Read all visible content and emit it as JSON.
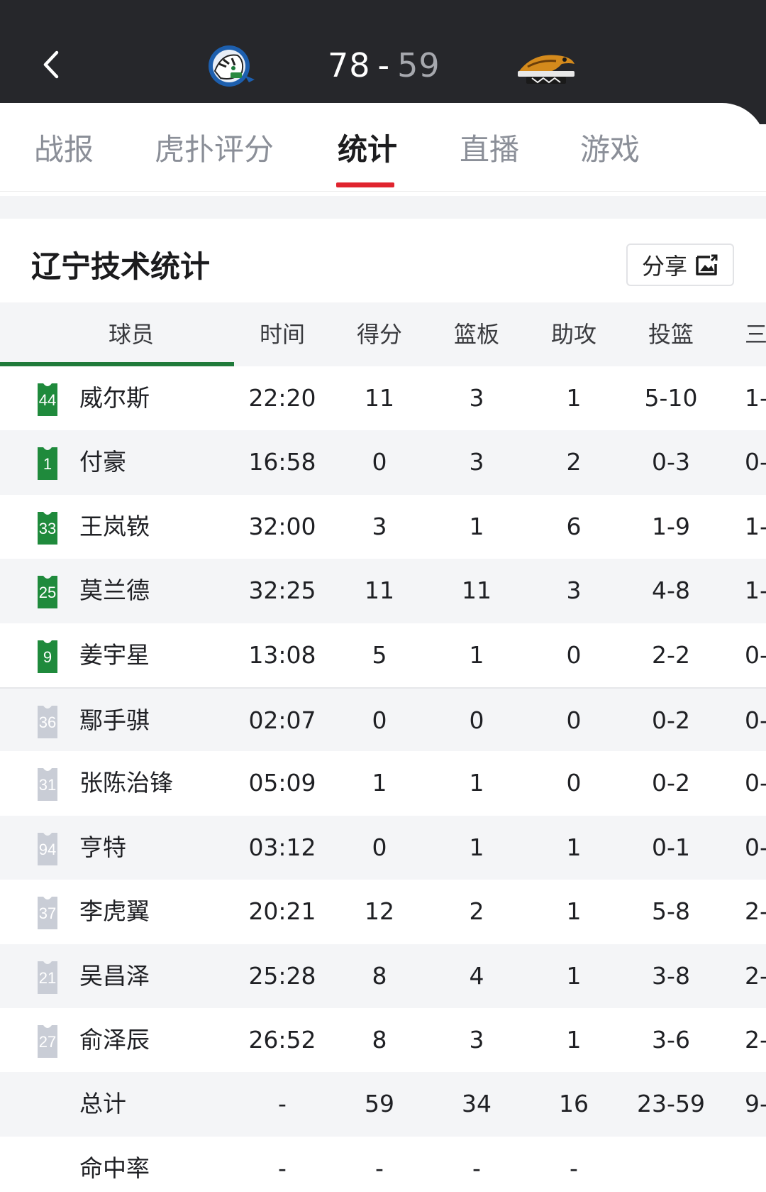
{
  "header": {
    "home_score": "78",
    "separator": "-",
    "away_score": "59",
    "home_logo": "flying-tigers-logo",
    "away_logo": "liaoning-leopards-logo"
  },
  "tabs": [
    {
      "label": "战报",
      "active": false
    },
    {
      "label": "虎扑评分",
      "active": false
    },
    {
      "label": "统计",
      "active": true
    },
    {
      "label": "直播",
      "active": false
    },
    {
      "label": "游戏",
      "active": false
    }
  ],
  "section": {
    "title": "辽宁技术统计",
    "share_label": "分享",
    "share_icon": "image-share-icon"
  },
  "colors": {
    "header_bg": "#26272b",
    "active_tab_indicator": "#e0242e",
    "starter_jersey": "#1f8a3c",
    "bench_jersey": "#c9cdd6",
    "player_tab_underline": "#1f7a3a"
  },
  "table": {
    "headers": [
      "球员",
      "时间",
      "得分",
      "篮板",
      "助攻",
      "投篮",
      "三"
    ],
    "rows": [
      {
        "num": "44",
        "name": "威尔斯",
        "time": "22:20",
        "pts": "11",
        "reb": "3",
        "ast": "1",
        "fg": "5-10",
        "tp": "1-",
        "starter": true
      },
      {
        "num": "1",
        "name": "付豪",
        "time": "16:58",
        "pts": "0",
        "reb": "3",
        "ast": "2",
        "fg": "0-3",
        "tp": "0-",
        "starter": true
      },
      {
        "num": "33",
        "name": "王岚嵚",
        "time": "32:00",
        "pts": "3",
        "reb": "1",
        "ast": "6",
        "fg": "1-9",
        "tp": "1-",
        "starter": true
      },
      {
        "num": "25",
        "name": "莫兰德",
        "time": "32:25",
        "pts": "11",
        "reb": "11",
        "ast": "3",
        "fg": "4-8",
        "tp": "1-",
        "starter": true
      },
      {
        "num": "9",
        "name": "姜宇星",
        "time": "13:08",
        "pts": "5",
        "reb": "1",
        "ast": "0",
        "fg": "2-2",
        "tp": "0-",
        "starter": true
      },
      {
        "num": "36",
        "name": "鄢手骐",
        "time": "02:07",
        "pts": "0",
        "reb": "0",
        "ast": "0",
        "fg": "0-2",
        "tp": "0-",
        "starter": false
      },
      {
        "num": "31",
        "name": "张陈治锋",
        "time": "05:09",
        "pts": "1",
        "reb": "1",
        "ast": "0",
        "fg": "0-2",
        "tp": "0-",
        "starter": false
      },
      {
        "num": "94",
        "name": "亨特",
        "time": "03:12",
        "pts": "0",
        "reb": "1",
        "ast": "1",
        "fg": "0-1",
        "tp": "0-",
        "starter": false
      },
      {
        "num": "37",
        "name": "李虎翼",
        "time": "20:21",
        "pts": "12",
        "reb": "2",
        "ast": "1",
        "fg": "5-8",
        "tp": "2-",
        "starter": false
      },
      {
        "num": "21",
        "name": "吴昌泽",
        "time": "25:28",
        "pts": "8",
        "reb": "4",
        "ast": "1",
        "fg": "3-8",
        "tp": "2-",
        "starter": false
      },
      {
        "num": "27",
        "name": "俞泽辰",
        "time": "26:52",
        "pts": "8",
        "reb": "3",
        "ast": "1",
        "fg": "3-6",
        "tp": "2-",
        "starter": false
      },
      {
        "num": "",
        "name": "总计",
        "time": "-",
        "pts": "59",
        "reb": "34",
        "ast": "16",
        "fg": "23-59",
        "tp": "9-",
        "starter": null
      },
      {
        "num": "",
        "name": "命中率",
        "time": "-",
        "pts": "-",
        "reb": "-",
        "ast": "-",
        "fg": "",
        "tp": "",
        "starter": null
      }
    ]
  }
}
